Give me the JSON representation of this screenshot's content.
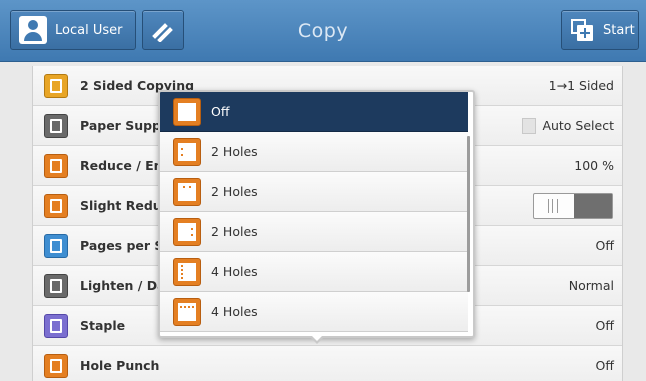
{
  "header": {
    "user_label": "Local User",
    "title": "Copy",
    "start_label": "Start"
  },
  "features": [
    {
      "label": "2 Sided Copying",
      "value": "1→1 Sided",
      "icon": "two-sided-icon"
    },
    {
      "label": "Paper Supply",
      "value": "Auto Select",
      "icon": "paper-tray-icon"
    },
    {
      "label": "Reduce / Enlarge",
      "value": "100 %",
      "icon": "reduce-enlarge-icon"
    },
    {
      "label": "Slight Reduction",
      "value": "",
      "icon": "slight-reduction-icon"
    },
    {
      "label": "Pages per Side",
      "value": "Off",
      "icon": "pages-per-side-icon"
    },
    {
      "label": "Lighten / Darken",
      "value": "Normal",
      "icon": "lighten-darken-icon"
    },
    {
      "label": "Staple",
      "value": "Off",
      "icon": "staple-icon"
    },
    {
      "label": "Hole Punch",
      "value": "Off",
      "icon": "hole-punch-icon"
    }
  ],
  "hole_punch_options": [
    {
      "label": "Off",
      "selected": true
    },
    {
      "label": "2 Holes",
      "selected": false
    },
    {
      "label": "2 Holes",
      "selected": false
    },
    {
      "label": "2 Holes",
      "selected": false
    },
    {
      "label": "4 Holes",
      "selected": false
    },
    {
      "label": "4 Holes",
      "selected": false
    }
  ],
  "colors": {
    "header_blue": "#3f79b1",
    "selected_option": "#1d3a5e",
    "icon_orange": "#e47f22"
  }
}
